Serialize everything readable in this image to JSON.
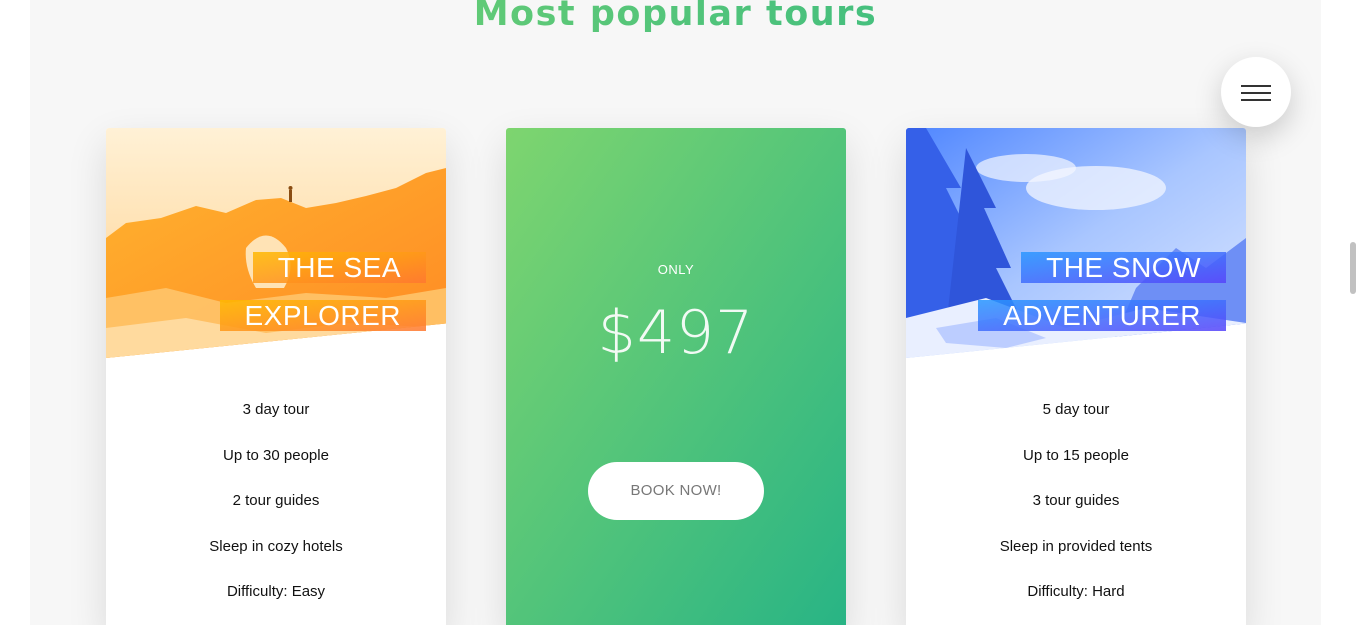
{
  "section": {
    "title": "Most popular tours"
  },
  "navigation": {
    "menu_icon": "hamburger-menu-icon"
  },
  "cards": [
    {
      "title": "THE SEA EXPLORER",
      "title_line1": "THE SEA",
      "title_line2": "EXPLORER",
      "theme": "orange",
      "gradient": [
        "#ffb900",
        "#ff7730"
      ],
      "details": [
        "3 day tour",
        "Up to 30 people",
        "2 tour guides",
        "Sleep in cozy hotels",
        "Difficulty: Easy"
      ]
    },
    {
      "price_label": "ONLY",
      "price": "$497",
      "button_label": "BOOK NOW!",
      "gradient": [
        "#7ed56f",
        "#28b485"
      ]
    },
    {
      "title": "THE SNOW ADVENTURER",
      "title_line1": "THE SNOW",
      "title_line2": "ADVENTURER",
      "theme": "blue",
      "gradient": [
        "#2998ff",
        "#5643fa"
      ],
      "details": [
        "5 day tour",
        "Up to 15 people",
        "3 tour guides",
        "Sleep in provided tents",
        "Difficulty: Hard"
      ]
    }
  ]
}
